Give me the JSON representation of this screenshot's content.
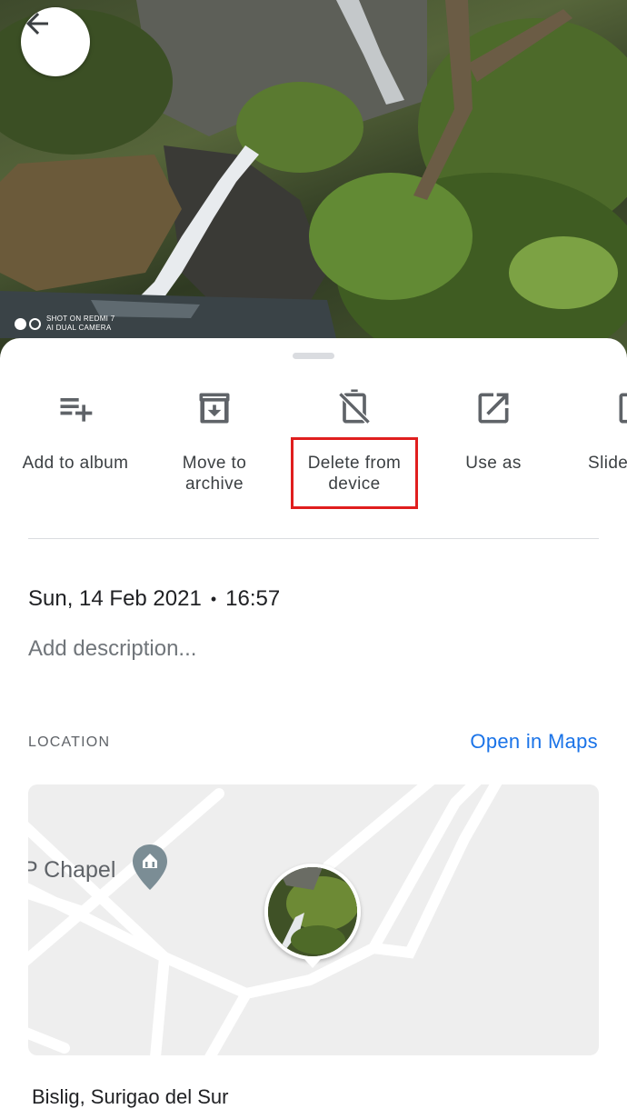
{
  "photo": {
    "watermark_line1": "SHOT ON REDMI 7",
    "watermark_line2": "AI DUAL CAMERA"
  },
  "nav": {
    "back_icon": "arrow-left-icon"
  },
  "actions": [
    {
      "label": "Add to album",
      "icon": "playlist-add-icon"
    },
    {
      "label": "Move to\narchive",
      "icon": "archive-icon"
    },
    {
      "label": "Delete from\ndevice",
      "icon": "phone-off-icon",
      "highlighted": true
    },
    {
      "label": "Use as",
      "icon": "open-external-icon"
    },
    {
      "label": "Slide",
      "icon": "slideshow-icon"
    }
  ],
  "details": {
    "date": "Sun, 14 Feb 2021",
    "separator": "•",
    "time": "16:57",
    "description_placeholder": "Add description..."
  },
  "location": {
    "heading": "LOCATION",
    "open_maps_label": "Open in Maps",
    "map_place_label": "P Chapel",
    "place_name": "Bislig, Surigao del Sur"
  },
  "colors": {
    "accent": "#1a73e8",
    "highlight_box": "#e01e1e"
  }
}
